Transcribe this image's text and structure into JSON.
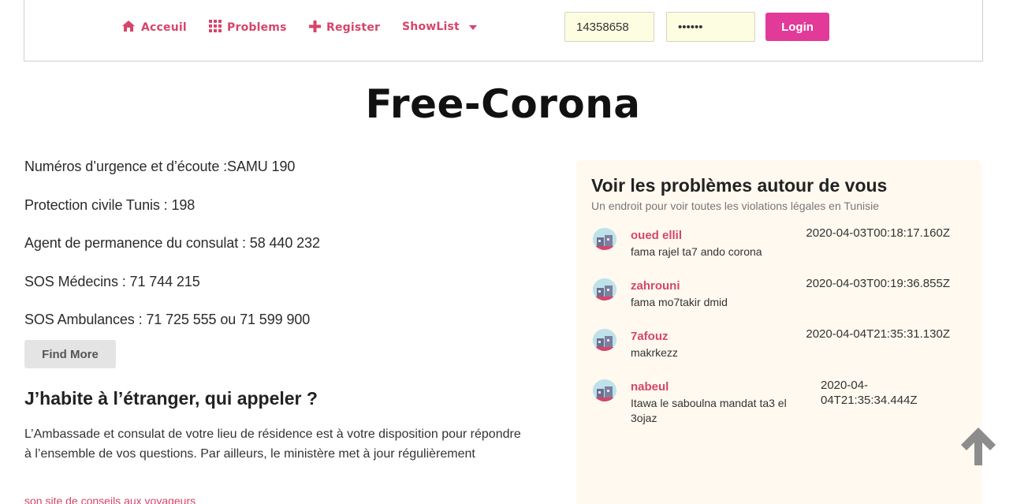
{
  "nav": {
    "home_label": "Acceuil",
    "problems_label": "Problems",
    "register_label": "Register",
    "showlist_label": "ShowList",
    "username_value": "14358658",
    "password_value": "••••••",
    "login_label": "Login",
    "accent_color": "#d6456a"
  },
  "title": "Free-Corona",
  "emergency": {
    "lines": [
      "Numéros d’urgence et d’écoute :SAMU 190",
      "Protection civile Tunis : 198",
      "Agent de permanence du consulat : 58 440 232",
      "SOS Médecins : 71 744 215",
      "SOS Ambulances : 71 725 555 ou 71 599 900"
    ],
    "find_more_label": "Find More"
  },
  "abroad": {
    "heading": "J’habite à l’étranger, qui appeler ?",
    "text": "L’Ambassade et consulat de votre lieu de résidence est à votre disposition pour répondre à l’ensemble de vos questions. Par ailleurs, le ministère met à jour régulièrement",
    "link_text": "son site de conseils aux voyageurs"
  },
  "panel": {
    "title": "Voir les problèmes autour de vous",
    "subtitle": "Un endroit pour voir toutes les violations légales en Tunisie",
    "items": [
      {
        "user": "oued ellil",
        "message": "fama rajel ta7 ando corona",
        "time": "2020-04-03T00:18:17.160Z"
      },
      {
        "user": "zahrouni",
        "message": "fama mo7takir dmid",
        "time": "2020-04-03T00:19:36.855Z"
      },
      {
        "user": "7afouz",
        "message": "makrkezz",
        "time": "2020-04-04T21:35:31.130Z"
      },
      {
        "user": "nabeul",
        "message": "Itawa le saboulna mandat ta3 el 3ojaz",
        "time": "2020-04-04T21:35:34.444Z"
      }
    ]
  },
  "icons": {
    "home": "home-icon",
    "problems": "grid-icon",
    "register": "plus-icon",
    "showlist": "caret-down-icon",
    "avatar": "avatar-icon",
    "scroll_top": "arrow-up-icon"
  }
}
